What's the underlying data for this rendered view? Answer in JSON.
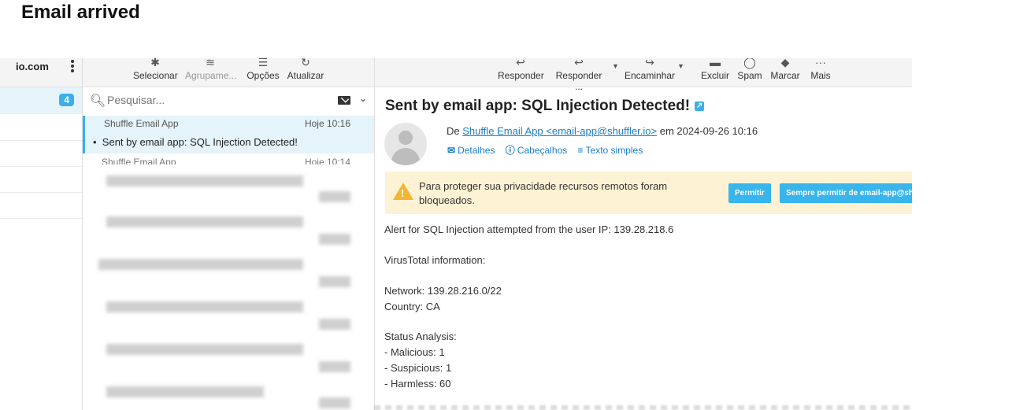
{
  "heading": "Email arrived",
  "account": {
    "name": "io.com",
    "inbox_count": "4"
  },
  "toolbar": {
    "select_label": "Selecionar",
    "group_label": "Agrupame...",
    "options_label": "Opções",
    "refresh_label": "Atualizar",
    "reply_label": "Responder",
    "reply_all_label": "Responder ...",
    "forward_label": "Encaminhar",
    "delete_label": "Excluir",
    "spam_label": "Spam",
    "mark_label": "Marcar",
    "more_label": "Mais"
  },
  "search": {
    "placeholder": "Pesquisar..."
  },
  "messages": [
    {
      "from": "Shuffle Email App",
      "date": "Hoje 10:16",
      "subject": "Sent by email app: SQL Injection Detected!",
      "bullet": "•"
    },
    {
      "from": "Shuffle Email App",
      "date": "Hoje 10:14"
    }
  ],
  "message": {
    "title": "Sent by email app: SQL Injection Detected!",
    "from_prefix": "De",
    "from_link": "Shuffle Email App <email-app@shuffler.io>",
    "from_suffix": "em 2024-09-26 10:16",
    "details_label": "Detalhes",
    "headers_label": "Cabeçalhos",
    "plain_label": "Texto simples",
    "notice_text": "Para proteger sua privacidade recursos remotos foram bloqueados.",
    "allow_label": "Permitir",
    "always_allow_label": "Sempre permitir de email-app@shuffler.io",
    "body": [
      "Alert for SQL Injection attempted from the user IP: 139.28.218.6",
      "VirusTotal information:",
      "Network: 139.28.216.0/22",
      "Country: CA",
      "Status Analysis:",
      "- Malicious: 1",
      "- Suspicious: 1",
      "- Harmless: 60"
    ]
  },
  "colors": {
    "accent": "#3daee9",
    "selected_bg": "#e5f3fb",
    "notice_bg": "#fdf3d4",
    "warning": "#f2b632",
    "link": "#1a7dc2"
  }
}
